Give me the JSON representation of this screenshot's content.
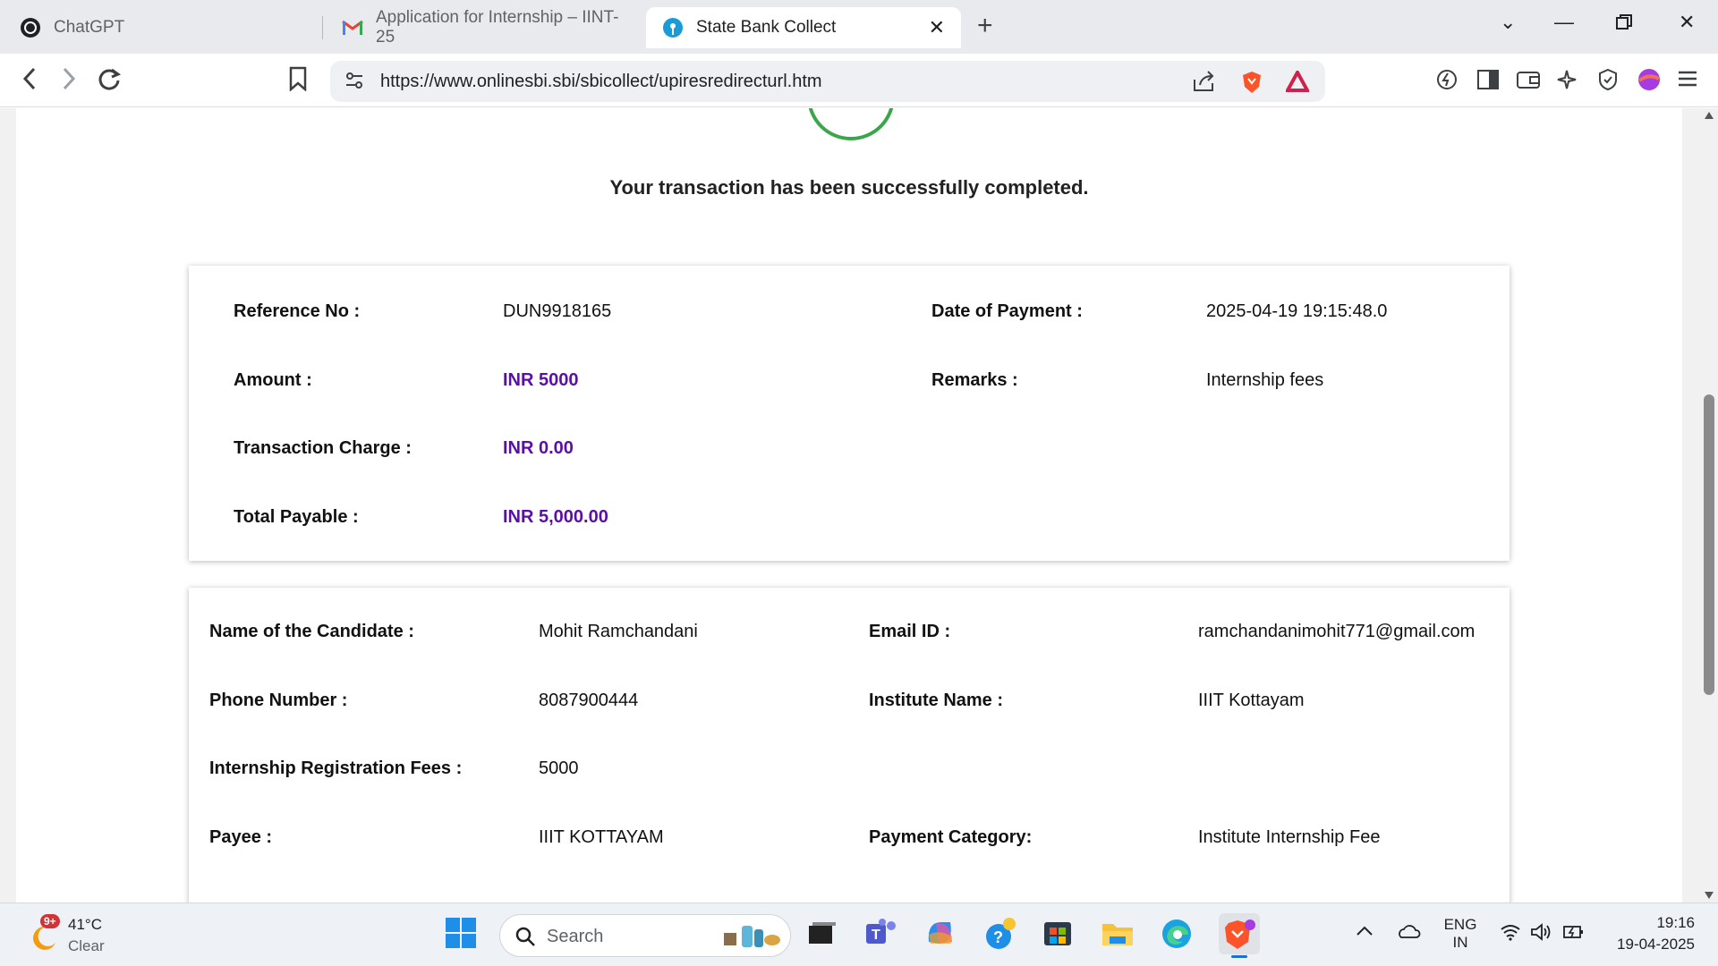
{
  "browser": {
    "tabs": [
      {
        "label": "ChatGPT"
      },
      {
        "label": "Application for Internship – IINT-25"
      },
      {
        "label": "State Bank Collect",
        "active": true
      }
    ],
    "url": "https://www.onlinesbi.sbi/sbicollect/upiresredirecturl.htm"
  },
  "page": {
    "success_message": "Your transaction has been successfully completed.",
    "payment": {
      "reference_label": "Reference No :",
      "reference_value": "DUN9918165",
      "date_label": "Date of Payment :",
      "date_value": "2025-04-19 19:15:48.0",
      "amount_label": "Amount :",
      "amount_value": "INR 5000",
      "remarks_label": "Remarks :",
      "remarks_value": "Internship fees",
      "charge_label": "Transaction Charge :",
      "charge_value": "INR 0.00",
      "total_label": "Total Payable :",
      "total_value": "INR 5,000.00"
    },
    "candidate": {
      "name_label": "Name of the Candidate :",
      "name_value": "Mohit Ramchandani",
      "email_label": "Email ID :",
      "email_value": "ramchandanimohit771@gmail.com",
      "phone_label": "Phone Number :",
      "phone_value": "8087900444",
      "institute_label": "Institute Name :",
      "institute_value": "IIIT Kottayam",
      "fees_label": "Internship Registration Fees :",
      "fees_value": "5000",
      "payee_label": "Payee :",
      "payee_value": "IIIT KOTTAYAM",
      "category_label": "Payment Category:",
      "category_value": "Institute Internship Fee"
    }
  },
  "taskbar": {
    "weather_temp": "41°C",
    "weather_cond": "Clear",
    "weather_badge": "9+",
    "search_placeholder": "Search",
    "lang_top": "ENG",
    "lang_bottom": "IN",
    "time": "19:16",
    "date": "19-04-2025"
  },
  "colors": {
    "accent_purple": "#5b0fa6",
    "success_green": "#3aa64a"
  }
}
